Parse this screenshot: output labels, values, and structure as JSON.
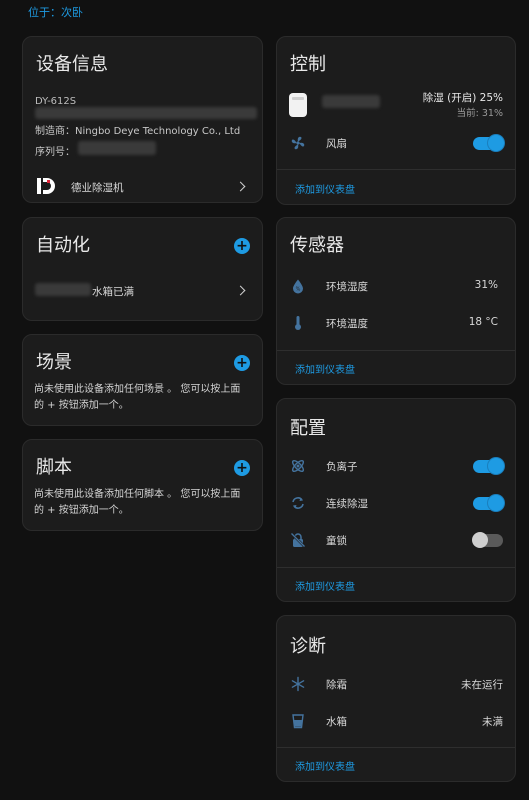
{
  "location": "位于：次卧",
  "device_info": {
    "title": "设备信息",
    "model": "DY-612S",
    "manufacturer_label": "制造商：",
    "manufacturer": "Ningbo Deye Technology Co., Ltd",
    "serial_label": "序列号：",
    "integration": "德业除湿机"
  },
  "automation": {
    "title": "自动化",
    "item_label": "水箱已满"
  },
  "scenes": {
    "title": "场景",
    "description": "尚未使用此设备添加任何场景 。 您可以按上面的 + 按钮添加一个。"
  },
  "scripts": {
    "title": "脚本",
    "description": "尚未使用此设备添加任何脚本 。 您可以按上面的 + 按钮添加一个。"
  },
  "controls": {
    "title": "控制",
    "humidifier_state": "除湿 (开启) 25%",
    "humidifier_current": "当前: 31%",
    "fan_label": "风扇",
    "add_to_dashboard": "添加到仪表盘"
  },
  "sensors": {
    "title": "传感器",
    "items": [
      {
        "label": "环境湿度",
        "value": "31%"
      },
      {
        "label": "环境温度",
        "value": "18 °C"
      }
    ],
    "add_to_dashboard": "添加到仪表盘"
  },
  "config": {
    "title": "配置",
    "items": [
      {
        "label": "负离子",
        "on": true
      },
      {
        "label": "连续除湿",
        "on": true
      },
      {
        "label": "童锁",
        "on": false
      }
    ],
    "add_to_dashboard": "添加到仪表盘"
  },
  "diagnostics": {
    "title": "诊断",
    "items": [
      {
        "label": "除霜",
        "value": "未在运行"
      },
      {
        "label": "水箱",
        "value": "未满"
      }
    ],
    "add_to_dashboard": "添加到仪表盘"
  },
  "colors": {
    "accent": "#1e9be3",
    "card": "#1c1c1c",
    "background": "#111111"
  },
  "icons": [
    "deye-logo-icon",
    "plus-icon",
    "chevron-right-icon",
    "fan-icon",
    "water-drop-icon",
    "thermometer-icon",
    "atom-icon",
    "sync-icon",
    "lock-off-icon",
    "snowflake-icon",
    "cup-icon"
  ]
}
